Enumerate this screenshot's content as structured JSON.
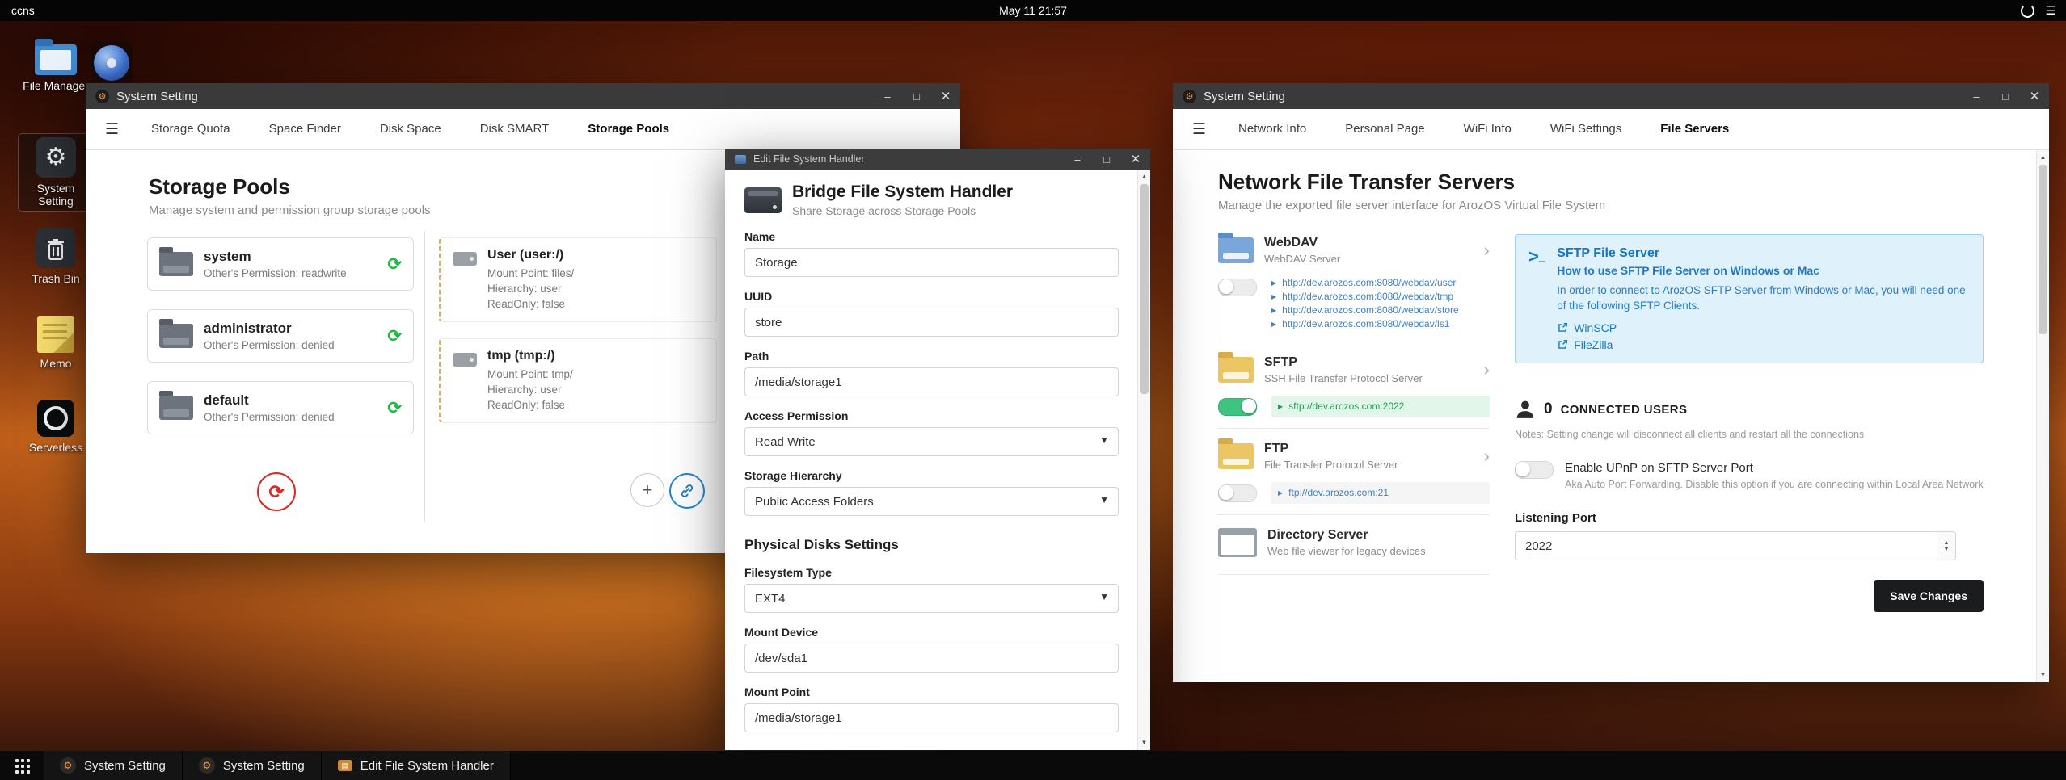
{
  "colors": {
    "accent_blue": "#2185d0",
    "positive_green": "#21ba45",
    "toggle_on_green": "#3fc380",
    "negative_red": "#db2828",
    "info_blue": "#1678c2",
    "info_panel_bg": "#dff1fb",
    "folder_yellow": "#ecc565",
    "folder_blue": "#79a7d9",
    "titlebar_gray": "#3a3a3a",
    "save_button_bg": "#1b1c1d"
  },
  "topbar": {
    "host": "ccns",
    "clock": "May 11 21:57"
  },
  "desktop": {
    "icons": [
      {
        "label": "File Manager"
      },
      {
        "label": "System Setting"
      },
      {
        "label": "Trash Bin"
      },
      {
        "label": "Memo"
      },
      {
        "label": "Serverless"
      }
    ]
  },
  "window_storage": {
    "title": "System Setting",
    "tabs": [
      "Storage Quota",
      "Space Finder",
      "Disk Space",
      "Disk SMART",
      "Storage Pools"
    ],
    "active_tab": "Storage Pools",
    "heading": "Storage Pools",
    "subheading": "Manage system and permission group storage pools",
    "pools": [
      {
        "name": "system",
        "perm": "Other's Permission: readwrite"
      },
      {
        "name": "administrator",
        "perm": "Other's Permission: denied"
      },
      {
        "name": "default",
        "perm": "Other's Permission: denied"
      }
    ],
    "mounts": [
      {
        "name": "User (user:/)",
        "lines": [
          "Mount Point: files/",
          "Hierarchy: user",
          "ReadOnly: false"
        ]
      },
      {
        "name": "tmp (tmp:/)",
        "lines": [
          "Mount Point: tmp/",
          "Hierarchy: user",
          "ReadOnly: false"
        ]
      }
    ]
  },
  "window_editor": {
    "title": "Edit File System Handler",
    "heading": "Bridge File System Handler",
    "subheading": "Share Storage across Storage Pools",
    "fields": {
      "name_label": "Name",
      "name_value": "Storage",
      "uuid_label": "UUID",
      "uuid_value": "store",
      "path_label": "Path",
      "path_value": "/media/storage1",
      "access_label": "Access Permission",
      "access_value": "Read Write",
      "hierarchy_label": "Storage Hierarchy",
      "hierarchy_value": "Public Access Folders",
      "section": "Physical Disks Settings",
      "fstype_label": "Filesystem Type",
      "fstype_value": "EXT4",
      "mount_device_label": "Mount Device",
      "mount_device_value": "/dev/sda1",
      "mount_point_label": "Mount Point",
      "mount_point_value": "/media/storage1"
    }
  },
  "window_servers": {
    "title": "System Setting",
    "tabs": [
      "Network Info",
      "Personal Page",
      "WiFi Info",
      "WiFi Settings",
      "File Servers"
    ],
    "active_tab": "File Servers",
    "heading": "Network File Transfer Servers",
    "subheading": "Manage the exported file server interface for ArozOS Virtual File System",
    "servers": [
      {
        "name": "WebDAV",
        "desc": "WebDAV Server",
        "enabled": false,
        "links": [
          "http://dev.arozos.com:8080/webdav/user",
          "http://dev.arozos.com:8080/webdav/tmp",
          "http://dev.arozos.com:8080/webdav/store",
          "http://dev.arozos.com:8080/webdav/ls1"
        ]
      },
      {
        "name": "SFTP",
        "desc": "SSH File Transfer Protocol Server",
        "enabled": true,
        "links": [
          "sftp://dev.arozos.com:2022"
        ]
      },
      {
        "name": "FTP",
        "desc": "File Transfer Protocol Server",
        "enabled": false,
        "links": [
          "ftp://dev.arozos.com:21"
        ]
      },
      {
        "name": "Directory Server",
        "desc": "Web file viewer for legacy devices",
        "links": []
      }
    ],
    "info_panel": {
      "title": "SFTP File Server",
      "subtitle": "How to use SFTP File Server on Windows or Mac",
      "body": "In order to connect to ArozOS SFTP Server from Windows or Mac, you will need one of the following SFTP Clients.",
      "clients": [
        "WinSCP",
        "FileZilla"
      ]
    },
    "connected": {
      "count": "0",
      "label": "CONNECTED USERS",
      "note": "Notes: Setting change will disconnect all clients and restart all the connections"
    },
    "upnp": {
      "label": "Enable UPnP on SFTP Server Port",
      "desc": "Aka Auto Port Forwarding. Disable this option if you are connecting within Local Area Network"
    },
    "port": {
      "label": "Listening Port",
      "value": "2022"
    },
    "save_label": "Save Changes"
  },
  "taskbar": {
    "items": [
      "System Setting",
      "System Setting",
      "Edit File System Handler"
    ]
  }
}
